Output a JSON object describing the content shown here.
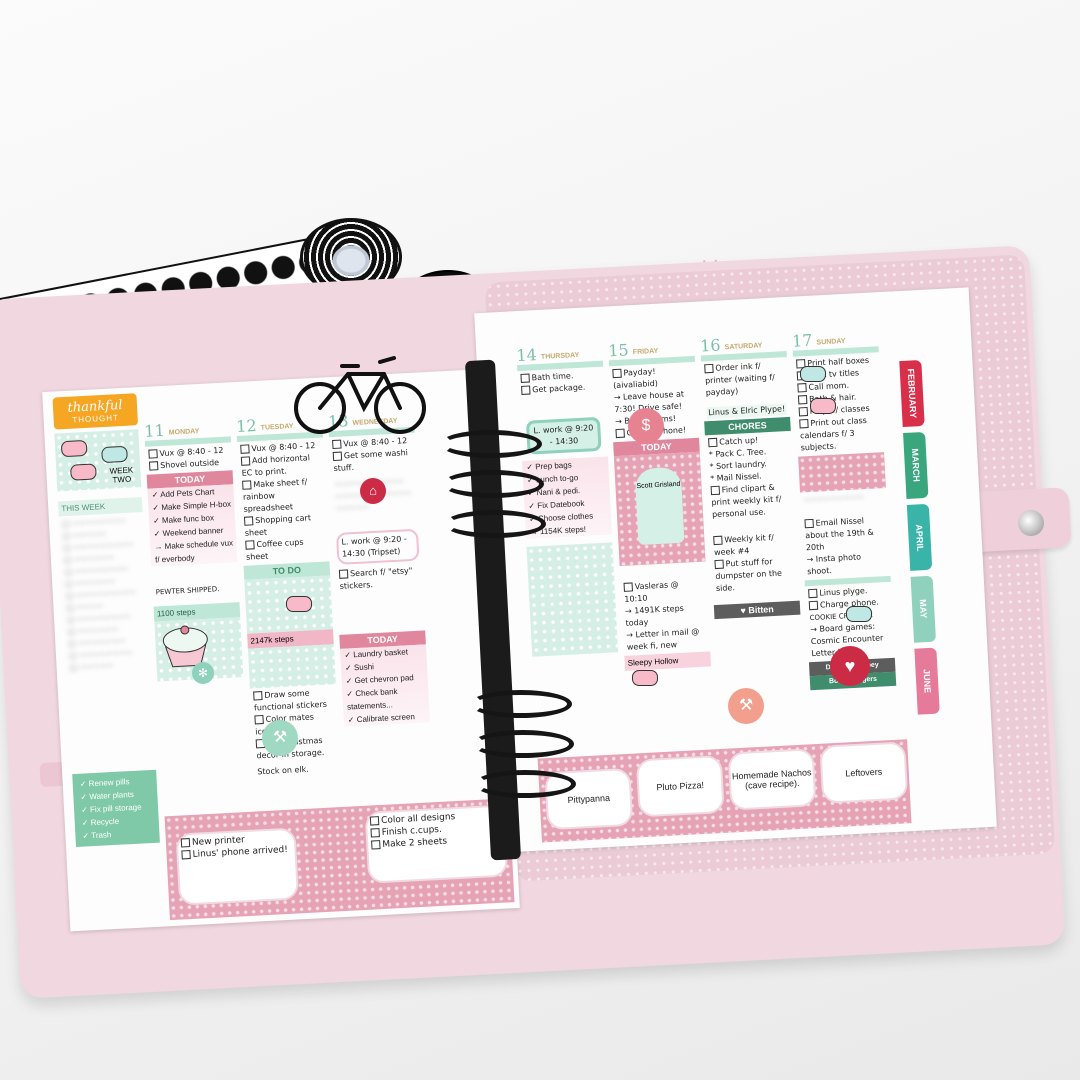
{
  "watermark": "www.nekkoart.net",
  "sidebar": {
    "header_title": "thankful",
    "header_sub": "THOUGHT",
    "week_label": "WEEK TWO",
    "this_week": "THIS WEEK",
    "checklist": [
      "Renew pills",
      "Water plants",
      "Fix pill storage",
      "Recycle",
      "Trash"
    ]
  },
  "days_left": [
    {
      "num": "11",
      "name": "MONDAY",
      "band": "TODAY",
      "top_notes": [
        "Vux @ 8:40 - 12",
        "Shovel outside"
      ],
      "tasks": [
        "Add Pets Chart",
        "Make Simple H-box",
        "Make func box",
        "Weekend banner",
        "Make schedule vux f/ everbody"
      ],
      "badge": "PEWTER SHIPPED.",
      "stat": "1100 steps"
    },
    {
      "num": "12",
      "name": "TUESDAY",
      "band": "TO DO",
      "top_notes": [
        "Vux @ 8:40 - 12",
        "Add horizontal EC to print.",
        "Make sheet f/ rainbow spreadsheet",
        "Shopping cart sheet",
        "Coffee cups sheet"
      ],
      "tasks": [
        "2147k steps",
        "Draw some functional stickers",
        "Color mates icons.",
        "Put Christmas decor in storage."
      ],
      "badge": "Stock on elk.",
      "stat": ""
    },
    {
      "num": "13",
      "name": "WEDNESDAY",
      "band": "TODAY",
      "top_notes": [
        "Vux @ 8:40 - 12",
        "Get some washi stuff."
      ],
      "tasks": [
        "L. work @ 9:20 - 14:30 (Tripset)",
        "Search f/ \"etsy\" stickers.",
        "Laundry basket",
        "Sushi",
        "Get chevron pad",
        "Check bank statements...",
        "Calibrate screen"
      ],
      "badge": "",
      "stat": ""
    }
  ],
  "bottom_left_notes": [
    "New printer",
    "Linus' phone arrived!",
    "Color all designs",
    "Finish c.cups.",
    "Make 2 sheets"
  ],
  "days_right": [
    {
      "num": "14",
      "name": "THURSDAY",
      "band": "",
      "top_notes": [
        "Bath time.",
        "Get package."
      ],
      "tasks": [
        "L. work @ 9:20 - 14:30",
        "Prep bags",
        "Lunch to-go",
        "Nani & pedi.",
        "Fix Datebook",
        "Choose clothes",
        "1154K steps!"
      ],
      "bottom": "Pittypanna"
    },
    {
      "num": "15",
      "name": "FRIDAY",
      "band": "TODAY",
      "top_notes": [
        "Payday! (aivaliabid)",
        "Leave house at 7:30! Drive safe!",
        "Bring rooms!",
        "Charge phone!"
      ],
      "tasks": [
        "Scott Grisland",
        "Vasleras @ 10:10",
        "1491K steps today",
        "Letter in mail @ week fi, new",
        "Sleepy Hollow"
      ],
      "bottom": "Pluto Pizza!"
    },
    {
      "num": "16",
      "name": "SATURDAY",
      "band": "CHORES",
      "top_notes": [
        "Order ink f/ printer (waiting f/ payday)",
        "Linus & Elric Plype!"
      ],
      "tasks": [
        "Catch up!",
        "Pack C. Tree.",
        "Sort laundry.",
        "Mail Nissel.",
        "Find clipart & print weekly kit f/ personal use.",
        "Weekly kit f/ week #4",
        "Put stuff for dumpster on the side."
      ],
      "bottom": "Homemade Nachos (cave recipe)."
    },
    {
      "num": "17",
      "name": "SUNDAY",
      "band": "",
      "top_notes": [
        "Print half boxes",
        "Print tv titles",
        "Call mom.",
        "Bath & hair.",
        "Prep. f/ classes",
        "Print out class calendars f/ 3 subjects."
      ],
      "tasks": [
        "Email Nissel about the 19th & 20th",
        "Insta photo shoot.",
        "Linus plyge.",
        "Charge phone.",
        "COOKIE CRUMBLE",
        "Board games: Cosmic Encounter Letter Jack",
        "Downton Abbey",
        "Bob's Burgers"
      ],
      "bottom": "Leftovers"
    }
  ],
  "stat_bitten": "Bitten",
  "tabs": [
    "FEBRUARY",
    "MARCH",
    "APRIL",
    "MAY",
    "JUNE"
  ],
  "colors": {
    "pink": "#e0879d",
    "mint": "#bfe7d8",
    "green": "#3f8d6d",
    "cover": "#f1d7df",
    "tab_red": "#d8304a",
    "tab_green": "#3aa67e",
    "tab_teal": "#3ab4a8",
    "tab_mint": "#8fd1bc",
    "tab_pink": "#e57a9a"
  }
}
